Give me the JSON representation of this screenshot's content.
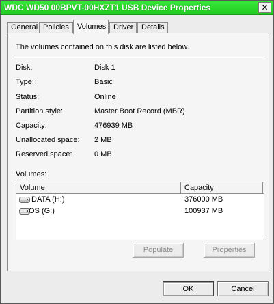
{
  "window": {
    "title": "WDC WD50 00BPVT-00HXZT1 USB Device Properties",
    "close_glyph": "✕"
  },
  "tabs": [
    {
      "label": "General"
    },
    {
      "label": "Policies"
    },
    {
      "label": "Volumes",
      "selected": true
    },
    {
      "label": "Driver"
    },
    {
      "label": "Details"
    }
  ],
  "panel": {
    "intro": "The volumes contained on this disk are listed below.",
    "fields": [
      {
        "label": "Disk:",
        "value": "Disk 1"
      },
      {
        "label": "Type:",
        "value": "Basic"
      },
      {
        "label": "Status:",
        "value": "Online"
      },
      {
        "label": "Partition style:",
        "value": "Master Boot Record (MBR)"
      },
      {
        "label": "Capacity:",
        "value": "476939 MB"
      },
      {
        "label": "Unallocated space:",
        "value": "2 MB"
      },
      {
        "label": "Reserved space:",
        "value": "0 MB"
      }
    ],
    "volumes_label": "Volumes:",
    "columns": [
      "Volume",
      "Capacity"
    ],
    "volumes": [
      {
        "name": "DATA (H:)",
        "capacity": "376000 MB",
        "icon": "drive-icon"
      },
      {
        "name": "OS (G:)",
        "capacity": "100937 MB",
        "icon": "drive-icon"
      }
    ],
    "populate_label": "Populate",
    "properties_label": "Properties"
  },
  "footer": {
    "ok_label": "OK",
    "cancel_label": "Cancel"
  },
  "colors": {
    "titlebar": "#22c922",
    "disabled_text": "#8d8d8d"
  }
}
